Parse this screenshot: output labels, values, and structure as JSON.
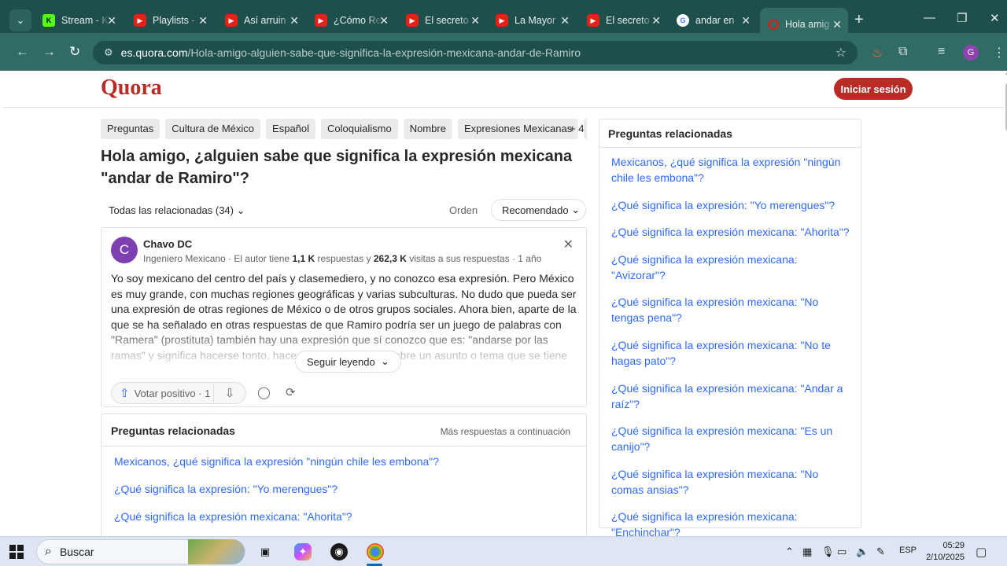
{
  "browser": {
    "tabs": [
      {
        "label": "Stream - K",
        "icon": "kick-icon"
      },
      {
        "label": "Playlists -",
        "icon": "youtube-icon"
      },
      {
        "label": "Así arruin",
        "icon": "youtube-icon"
      },
      {
        "label": "¿Cómo Re",
        "icon": "youtube-icon"
      },
      {
        "label": "El secreto",
        "icon": "youtube-icon"
      },
      {
        "label": "La Mayor",
        "icon": "youtube-icon"
      },
      {
        "label": "El secreto",
        "icon": "youtube-icon"
      },
      {
        "label": "andar en",
        "icon": "google-icon"
      },
      {
        "label": "Hola amig",
        "icon": "quora-icon",
        "active": true
      }
    ],
    "url_host": "es.quora.com",
    "url_path": "/Hola-amigo-alguien-sabe-que-significa-la-expresión-mexicana-andar-de-Ramiro",
    "profile_initial": "G"
  },
  "quora": {
    "logo": "Quora",
    "login_label": "Iniciar sesión",
    "topics": [
      "Preguntas",
      "Cultura de México",
      "Español",
      "Coloquialismo",
      "Nombre",
      "Expresiones Mexicanas",
      "E"
    ],
    "more_topics": "+ 4",
    "question_title": "Hola amigo, ¿alguien sabe que significa la expresión mexicana \"andar de Ramiro\"?",
    "filter_label": "Todas las relacionadas (34)",
    "order_label": "Orden",
    "sort_value": "Recomendado",
    "answer": {
      "author_initial": "C",
      "author_name": "Chavo DC",
      "meta_prefix": "Ingeniero Mexicano · El autor tiene ",
      "answers_count": "1,1 K",
      "meta_mid": " respuestas y ",
      "views_count": "262,3 K",
      "meta_suffix": " visitas a sus respuestas · 1 año",
      "text": "Yo soy mexicano del centro del país y clasemediero, y no conozco esa expresión. Pero México es muy grande, con muchas regiones geográficas y varias subculturas. No dudo que pueda ser una expresión de otras regiones de México o de otros grupos sociales. Ahora bien, aparte de la que se ha señalado en otras respuestas de que Ramiro podría ser un juego de palabras con \"Ramera\" (prostituta) también hay una expresión que sí conozco que es: \"andarse por las ramas\" y significa hacerse tonto, hacer como que hablar sobre un asunto o tema que se tiene que tratar o atender. Andar de Ramiro...",
      "read_more": "Seguir leyendo",
      "upvote_label": "Votar positivo · 1"
    },
    "related_inline": {
      "heading": "Preguntas relacionadas",
      "more": "Más respuestas a continuación",
      "items": [
        "Mexicanos, ¿qué significa la expresión \"ningún chile les embona\"?",
        "¿Qué significa la expresión: \"Yo merengues\"?",
        "¿Qué significa la expresión mexicana: \"Ahorita\"?"
      ]
    },
    "related_side": {
      "heading": "Preguntas relacionadas",
      "items": [
        "Mexicanos, ¿qué significa la expresión \"ningún chile les embona\"?",
        "¿Qué significa la expresión: \"Yo merengues\"?",
        "¿Qué significa la expresión mexicana: \"Ahorita\"?",
        "¿Qué significa la expresión mexicana: \"Avizorar\"?",
        "¿Qué significa la expresión mexicana: \"No tengas pena\"?",
        "¿Qué significa la expresión mexicana: \"No te hagas pato\"?",
        "¿Qué significa la expresión mexicana: \"Andar a raíz\"?",
        "¿Qué significa la expresión mexicana: \"Es un canijo\"?",
        "¿Qué significa la expresión mexicana: \"No comas ansias\"?",
        "¿Qué significa la expresión mexicana: \"Enchinchar\"?"
      ]
    }
  },
  "taskbar": {
    "search_placeholder": "Buscar",
    "language": "ESP",
    "time": "05:29",
    "date": "2/10/2025"
  },
  "colors": {
    "quora_red": "#b92b27",
    "link_blue": "#2e69ff",
    "chrome_frame": "#1f4f4a"
  }
}
